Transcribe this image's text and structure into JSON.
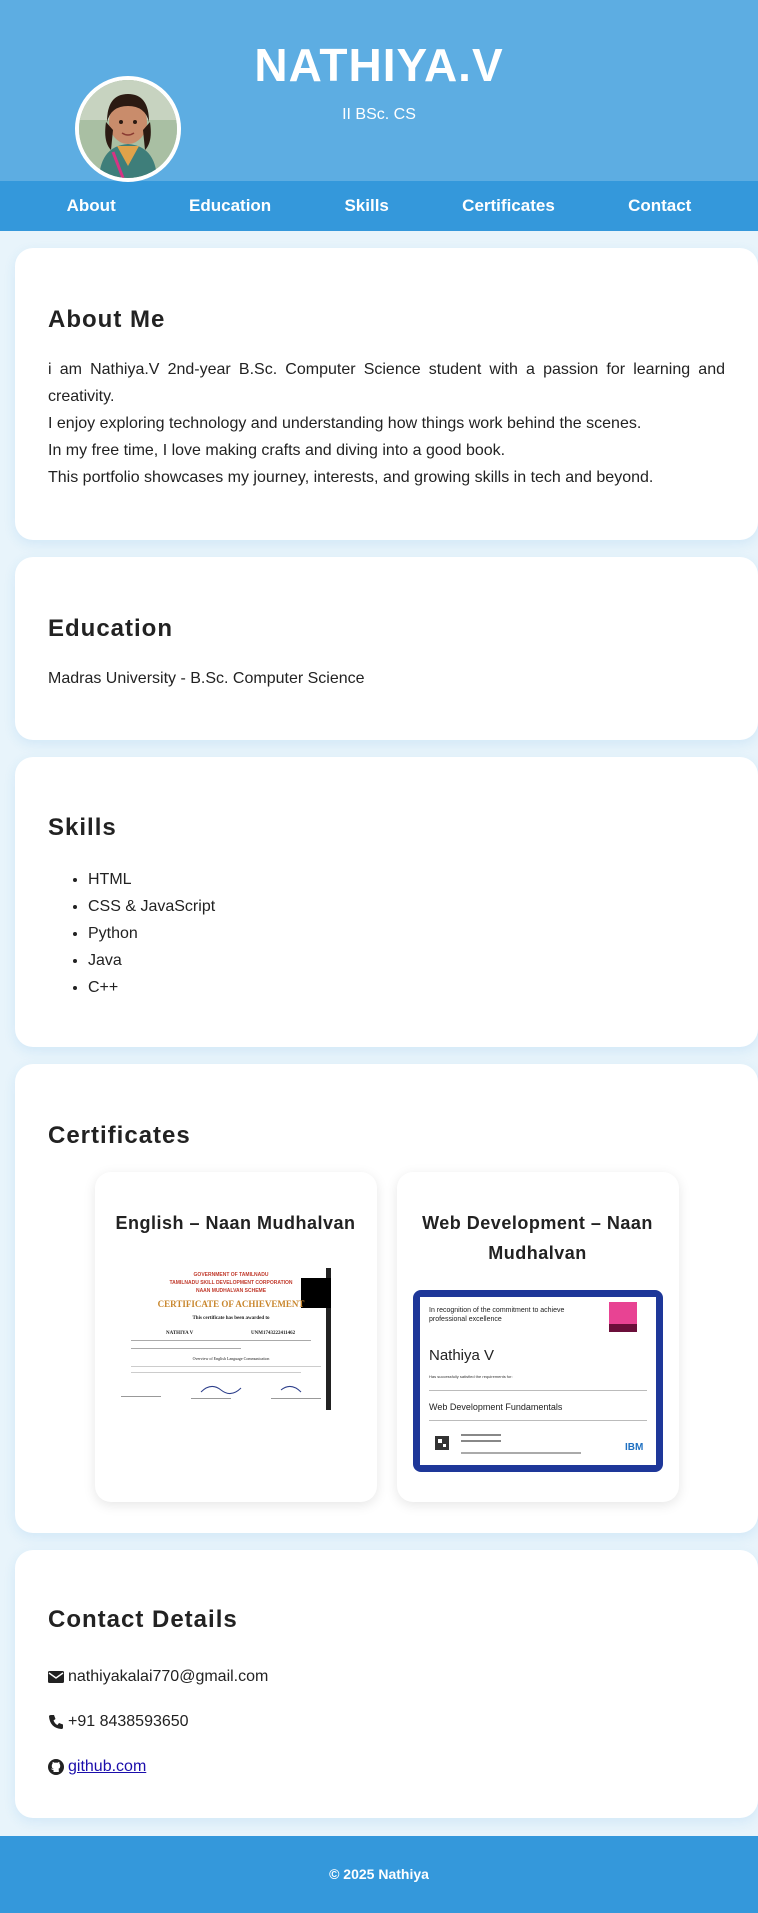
{
  "header": {
    "name": "NATHIYA.V",
    "subtitle": "II BSc. CS"
  },
  "nav": {
    "items": [
      {
        "label": "About"
      },
      {
        "label": "Education"
      },
      {
        "label": "Skills"
      },
      {
        "label": "Certificates"
      },
      {
        "label": "Contact"
      }
    ]
  },
  "about": {
    "title": "About Me",
    "lines": [
      "i am Nathiya.V 2nd-year B.Sc. Computer Science student with a passion for learning and creativity.",
      "I enjoy exploring technology and understanding how things work behind the scenes.",
      "In my free time, I love making crafts and diving into a good book.",
      "This portfolio showcases my journey, interests, and growing skills in tech and beyond."
    ]
  },
  "education": {
    "title": "Education",
    "text": "Madras University - B.Sc. Computer Science"
  },
  "skills": {
    "title": "Skills",
    "items": [
      "HTML",
      "CSS & JavaScript",
      "Python",
      "Java",
      "C++"
    ]
  },
  "certificates": {
    "title": "Certificates",
    "cards": [
      {
        "title": "English – Naan Mudhalvan",
        "image": {
          "header1": "GOVERNMENT OF TAMILNADU",
          "header2": "TAMILNADU SKILL DEVELOPMENT CORPORATION",
          "header3": "NAAN MUDHALVAN SCHEME",
          "heading": "CERTIFICATE OF ACHIEVEMENT",
          "awarded": "This certificate has been awarded to",
          "name": "NATHIYA V",
          "reg": "UNM1743222411462",
          "course": "Overview of English Language Communication"
        }
      },
      {
        "title": "Web Development – Naan Mudhalvan",
        "image": {
          "intro": "In recognition of the commitment to achieve professional excellence",
          "name": "Nathiya V",
          "satisfied": "Has successfully satisfied the requirements for:",
          "course": "Web Development Fundamentals",
          "brand": "IBM"
        }
      }
    ]
  },
  "contact": {
    "title": "Contact Details",
    "email": "nathiyakalai770@gmail.com",
    "phone": "+91 8438593650",
    "github": "github.com"
  },
  "footer": {
    "text": "© 2025 Nathiya"
  },
  "colors": {
    "header_bg": "#5dade2",
    "nav_bg": "#3498db",
    "page_bg": "#e8f4fb",
    "cert_border": "#1e3799"
  }
}
